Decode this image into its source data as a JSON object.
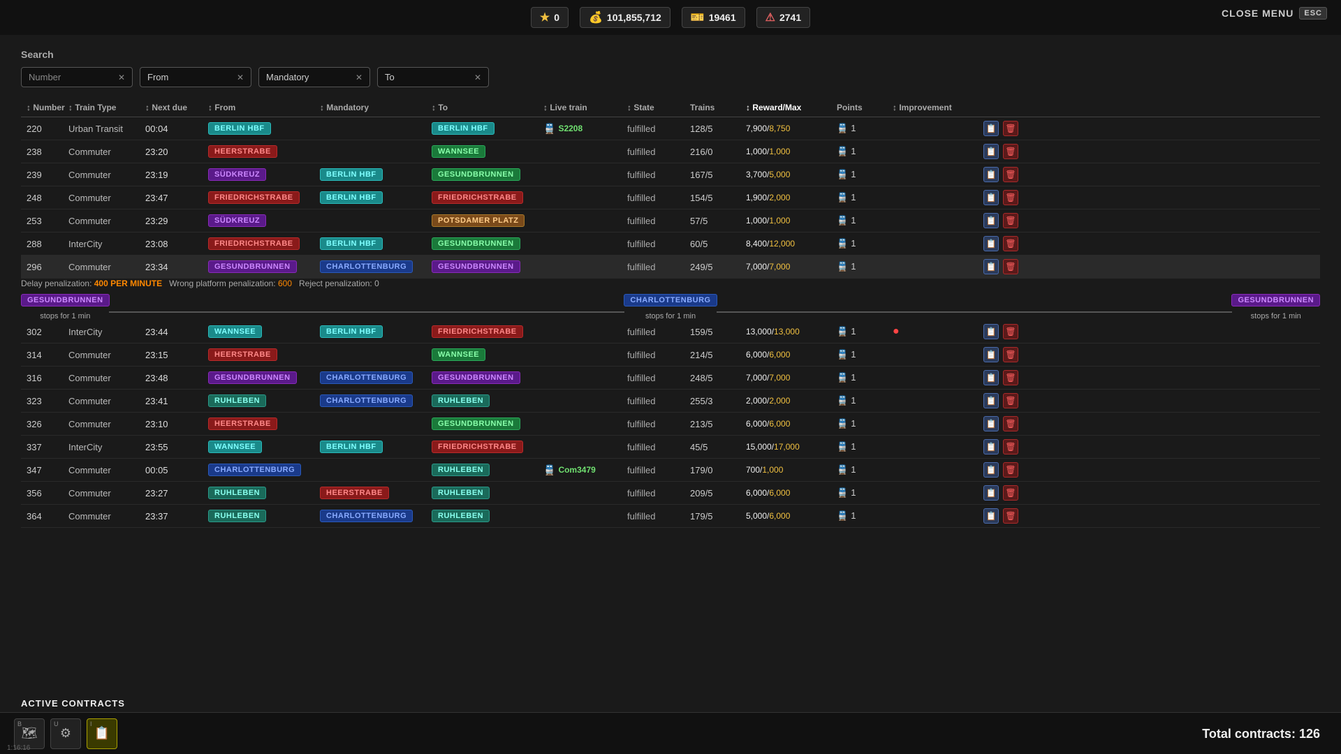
{
  "topbar": {
    "stars": "0",
    "cash": "101,855,712",
    "tickets": "19461",
    "alerts": "2741",
    "close_menu": "CLOSE MENU",
    "esc": "ESC"
  },
  "search": {
    "label": "Search",
    "filters": [
      {
        "id": "number",
        "placeholder": "Number",
        "value": ""
      },
      {
        "id": "from",
        "placeholder": "From",
        "value": "From"
      },
      {
        "id": "mandatory",
        "placeholder": "Mandatory",
        "value": "Mandatory"
      },
      {
        "id": "to",
        "placeholder": "To",
        "value": "To"
      }
    ]
  },
  "table": {
    "headers": [
      "Number",
      "Train Type",
      "Next due",
      "From",
      "Mandatory",
      "To",
      "Live train",
      "State",
      "Trains",
      "Reward/Max",
      "Points",
      "Improvement",
      ""
    ],
    "rows": [
      {
        "num": "220",
        "type": "Urban Transit",
        "next": "00:04",
        "from": {
          "label": "Berlin HBF",
          "color": "cyan"
        },
        "mandatory": "",
        "to": {
          "label": "Berlin HBF",
          "color": "cyan"
        },
        "live": "S2208",
        "live_color": "green",
        "state": "fulfilled",
        "trains": "128/5",
        "reward": "7,900",
        "max": "8,750",
        "points": "1",
        "improvement": "",
        "selected": false
      },
      {
        "num": "238",
        "type": "Commuter",
        "next": "23:20",
        "from": {
          "label": "Heerstrabe",
          "color": "red"
        },
        "mandatory": "",
        "to": {
          "label": "Wannsee",
          "color": "green"
        },
        "live": "",
        "live_color": "",
        "state": "fulfilled",
        "trains": "216/0",
        "reward": "1,000",
        "max": "1,000",
        "points": "1",
        "improvement": "",
        "selected": false
      },
      {
        "num": "239",
        "type": "Commuter",
        "next": "23:19",
        "from": {
          "label": "Südkreuz",
          "color": "purple"
        },
        "mandatory": {
          "label": "Berlin HBF",
          "color": "cyan"
        },
        "to": {
          "label": "Gesundbrunnen",
          "color": "green"
        },
        "live": "",
        "live_color": "",
        "state": "fulfilled",
        "trains": "167/5",
        "reward": "3,700",
        "max": "5,000",
        "points": "1",
        "improvement": "",
        "selected": false
      },
      {
        "num": "248",
        "type": "Commuter",
        "next": "23:47",
        "from": {
          "label": "Friedrichstrabe",
          "color": "red"
        },
        "mandatory": {
          "label": "Berlin HBF",
          "color": "cyan"
        },
        "to": {
          "label": "Friedrichstrabe",
          "color": "red"
        },
        "live": "",
        "live_color": "",
        "state": "fulfilled",
        "trains": "154/5",
        "reward": "1,900",
        "max": "2,000",
        "points": "1",
        "improvement": "",
        "selected": false
      },
      {
        "num": "253",
        "type": "Commuter",
        "next": "23:29",
        "from": {
          "label": "Südkreuz",
          "color": "purple"
        },
        "mandatory": "",
        "to": {
          "label": "Potsdamer Platz",
          "color": "orange"
        },
        "live": "",
        "live_color": "",
        "state": "fulfilled",
        "trains": "57/5",
        "reward": "1,000",
        "max": "1,000",
        "points": "1",
        "improvement": "",
        "selected": false
      },
      {
        "num": "288",
        "type": "InterCity",
        "next": "23:08",
        "from": {
          "label": "Friedrichstrabe",
          "color": "red"
        },
        "mandatory": {
          "label": "Berlin HBF",
          "color": "cyan"
        },
        "to": {
          "label": "Gesundbrunnen",
          "color": "green"
        },
        "live": "",
        "live_color": "",
        "state": "fulfilled",
        "trains": "60/5",
        "reward": "8,400",
        "max": "12,000",
        "points": "1",
        "improvement": "",
        "selected": false
      },
      {
        "num": "296",
        "type": "Commuter",
        "next": "23:34",
        "from": {
          "label": "Gesundbrunnen",
          "color": "purple"
        },
        "mandatory": {
          "label": "Charlottenburg",
          "color": "blue"
        },
        "to": {
          "label": "Gesundbrunnen",
          "color": "purple"
        },
        "live": "",
        "live_color": "",
        "state": "fulfilled",
        "trains": "249/5",
        "reward": "7,000",
        "max": "7,000",
        "points": "1",
        "improvement": "",
        "selected": true
      },
      {
        "num": "302",
        "type": "InterCity",
        "next": "23:44",
        "from": {
          "label": "Wannsee",
          "color": "cyan"
        },
        "mandatory": {
          "label": "Berlin HBF",
          "color": "cyan"
        },
        "to": {
          "label": "Friedrichstrabe",
          "color": "red"
        },
        "live": "",
        "live_color": "",
        "state": "fulfilled",
        "trains": "159/5",
        "reward": "13,000",
        "max": "13,000",
        "points": "1",
        "improvement": "warn",
        "selected": false
      },
      {
        "num": "314",
        "type": "Commuter",
        "next": "23:15",
        "from": {
          "label": "Heerstrabe",
          "color": "red"
        },
        "mandatory": "",
        "to": {
          "label": "Wannsee",
          "color": "green"
        },
        "live": "",
        "live_color": "",
        "state": "fulfilled",
        "trains": "214/5",
        "reward": "6,000",
        "max": "6,000",
        "points": "1",
        "improvement": "",
        "selected": false
      },
      {
        "num": "316",
        "type": "Commuter",
        "next": "23:48",
        "from": {
          "label": "Gesundbrunnen",
          "color": "purple"
        },
        "mandatory": {
          "label": "Charlottenburg",
          "color": "blue"
        },
        "to": {
          "label": "Gesundbrunnen",
          "color": "purple"
        },
        "live": "",
        "live_color": "",
        "state": "fulfilled",
        "trains": "248/5",
        "reward": "7,000",
        "max": "7,000",
        "points": "1",
        "improvement": "",
        "selected": false
      },
      {
        "num": "323",
        "type": "Commuter",
        "next": "23:41",
        "from": {
          "label": "Ruhleben",
          "color": "teal"
        },
        "mandatory": {
          "label": "Charlottenburg",
          "color": "blue"
        },
        "to": {
          "label": "Ruhleben",
          "color": "teal"
        },
        "live": "",
        "live_color": "",
        "state": "fulfilled",
        "trains": "255/3",
        "reward": "2,000",
        "max": "2,000",
        "points": "1",
        "improvement": "",
        "selected": false
      },
      {
        "num": "326",
        "type": "Commuter",
        "next": "23:10",
        "from": {
          "label": "Heerstrabe",
          "color": "red"
        },
        "mandatory": "",
        "to": {
          "label": "Gesundbrunnen",
          "color": "green"
        },
        "live": "",
        "live_color": "",
        "state": "fulfilled",
        "trains": "213/5",
        "reward": "6,000",
        "max": "6,000",
        "points": "1",
        "improvement": "",
        "selected": false
      },
      {
        "num": "337",
        "type": "InterCity",
        "next": "23:55",
        "from": {
          "label": "Wannsee",
          "color": "cyan"
        },
        "mandatory": {
          "label": "Berlin HBF",
          "color": "cyan"
        },
        "to": {
          "label": "Friedrichstrabe",
          "color": "red"
        },
        "live": "",
        "live_color": "",
        "state": "fulfilled",
        "trains": "45/5",
        "reward": "15,000",
        "max": "17,000",
        "points": "1",
        "improvement": "",
        "selected": false
      },
      {
        "num": "347",
        "type": "Commuter",
        "next": "00:05",
        "from": {
          "label": "Charlottenburg",
          "color": "blue"
        },
        "mandatory": "",
        "to": {
          "label": "Ruhleben",
          "color": "teal"
        },
        "live": "Com3479",
        "live_color": "green",
        "state": "fulfilled",
        "trains": "179/0",
        "reward": "700",
        "max": "1,000",
        "points": "1",
        "improvement": "",
        "selected": false
      },
      {
        "num": "356",
        "type": "Commuter",
        "next": "23:27",
        "from": {
          "label": "Ruhleben",
          "color": "teal"
        },
        "mandatory": {
          "label": "Heerstrabe",
          "color": "red"
        },
        "to": {
          "label": "Ruhleben",
          "color": "teal"
        },
        "live": "",
        "live_color": "",
        "state": "fulfilled",
        "trains": "209/5",
        "reward": "6,000",
        "max": "6,000",
        "points": "1",
        "improvement": "",
        "selected": false
      },
      {
        "num": "364",
        "type": "Commuter",
        "next": "23:37",
        "from": {
          "label": "Ruhleben",
          "color": "teal"
        },
        "mandatory": {
          "label": "Charlottenburg",
          "color": "blue"
        },
        "to": {
          "label": "Ruhleben",
          "color": "teal"
        },
        "live": "",
        "live_color": "",
        "state": "fulfilled",
        "trains": "179/5",
        "reward": "5,000",
        "max": "6,000",
        "points": "1",
        "improvement": "",
        "selected": false
      }
    ],
    "expanded_row_index": 6,
    "expanded": {
      "delay_per_min": "400 PER MINUTE",
      "platform_pen": "600",
      "reject_pen": "0",
      "stops": [
        {
          "label": "Gesundbrunnen",
          "color": "purple",
          "sub": "stops for 1 min"
        },
        {
          "label": "Charlottenburg",
          "color": "blue",
          "sub": "stops for 1 min"
        },
        {
          "label": "Gesundbrunnen",
          "color": "purple",
          "sub": "stops for 1 min"
        }
      ]
    }
  },
  "bottom": {
    "tools": [
      {
        "key": "B",
        "icon": "🗺",
        "active": false,
        "name": "map"
      },
      {
        "key": "U",
        "icon": "⚙",
        "active": false,
        "name": "settings"
      },
      {
        "key": "I",
        "icon": "📋",
        "active": true,
        "name": "contracts"
      }
    ],
    "total_contracts_label": "Total contracts:",
    "total_contracts_value": "126",
    "active_contracts": "ACTIVE CONTRACTS",
    "time": "1:16:16"
  }
}
